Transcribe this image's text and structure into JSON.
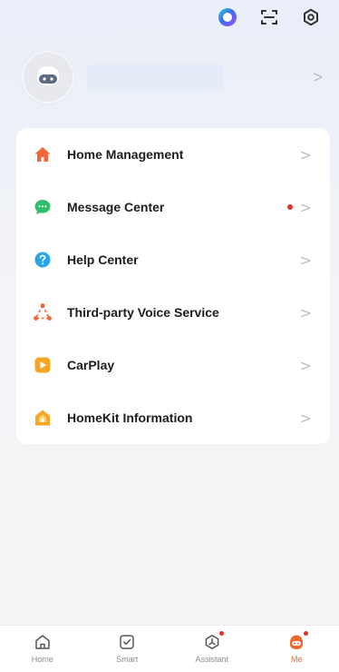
{
  "header": {
    "icons": [
      "assistant-orb-icon",
      "scan-icon",
      "settings-icon"
    ]
  },
  "profile": {
    "avatar_icon": "robot-avatar-icon",
    "chevron": ">"
  },
  "menu": {
    "items": [
      {
        "label": "Home Management",
        "icon": "house-icon",
        "color": "#f0673a",
        "badge": false
      },
      {
        "label": "Message Center",
        "icon": "chat-bubble-icon",
        "color": "#2fbf6b",
        "badge": true
      },
      {
        "label": "Help Center",
        "icon": "question-icon",
        "color": "#2aa6e8",
        "badge": false
      },
      {
        "label": "Third-party Voice Service",
        "icon": "voice-service-icon",
        "color": "#f0673a",
        "badge": false
      },
      {
        "label": "CarPlay",
        "icon": "carplay-icon",
        "color": "#f5a623",
        "badge": false
      },
      {
        "label": "HomeKit Information",
        "icon": "homekit-icon",
        "color": "#f5a623",
        "badge": false
      }
    ],
    "chevron": ">"
  },
  "tabbar": {
    "tabs": [
      {
        "label": "Home",
        "icon": "home-tab-icon",
        "active": false,
        "badge": false
      },
      {
        "label": "Smart",
        "icon": "smart-tab-icon",
        "active": false,
        "badge": false
      },
      {
        "label": "Assistant",
        "icon": "assistant-tab-icon",
        "active": false,
        "badge": true
      },
      {
        "label": "Me",
        "icon": "me-tab-icon",
        "active": true,
        "badge": true
      }
    ]
  },
  "colors": {
    "accent": "#f06a2f",
    "badge": "#e5322d",
    "background": "#f4f4f6"
  }
}
